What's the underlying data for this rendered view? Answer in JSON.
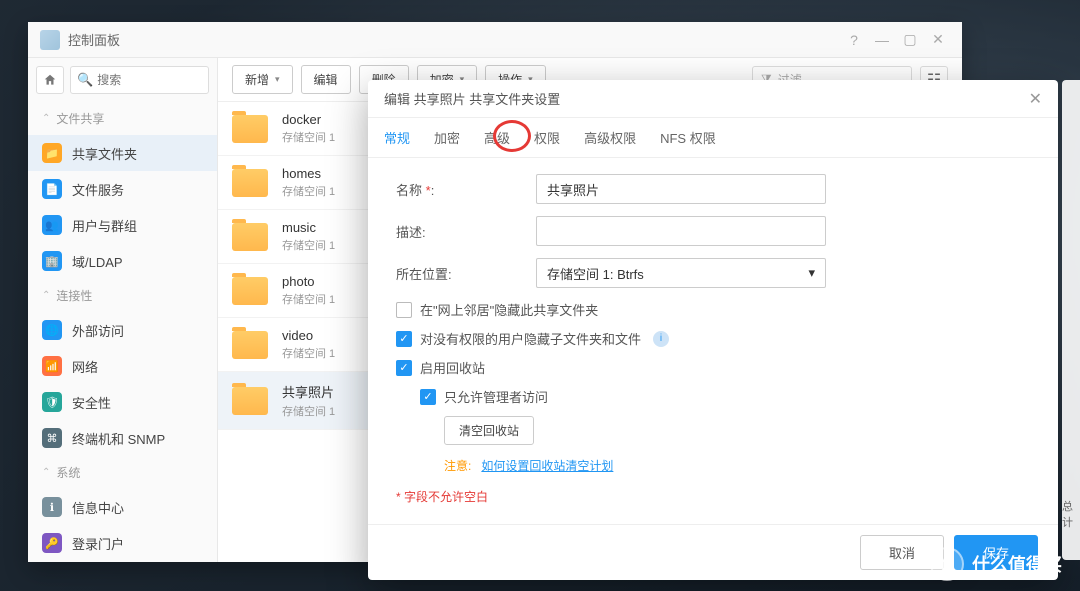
{
  "window": {
    "title": "控制面板"
  },
  "search": {
    "placeholder": "搜索"
  },
  "sections": {
    "file_share": "文件共享",
    "connectivity": "连接性",
    "system": "系统"
  },
  "nav": {
    "shared_folders": "共享文件夹",
    "file_services": "文件服务",
    "users_groups": "用户与群组",
    "domain_ldap": "域/LDAP",
    "external_access": "外部访问",
    "network": "网络",
    "security": "安全性",
    "terminal_snmp": "终端机和 SNMP",
    "info_center": "信息中心",
    "login_portal": "登录门户"
  },
  "toolbar": {
    "new": "新增",
    "edit": "编辑",
    "delete": "删除",
    "encrypt": "加密",
    "action": "操作",
    "filter_placeholder": "过滤"
  },
  "folders": [
    {
      "name": "docker",
      "location": "存储空间 1"
    },
    {
      "name": "homes",
      "location": "存储空间 1"
    },
    {
      "name": "music",
      "location": "存储空间 1"
    },
    {
      "name": "photo",
      "location": "存储空间 1"
    },
    {
      "name": "video",
      "location": "存储空间 1"
    },
    {
      "name": "共享照片",
      "location": "存储空间 1"
    }
  ],
  "dialog": {
    "title": "编辑 共享照片 共享文件夹设置",
    "tabs": {
      "general": "常规",
      "encryption": "加密",
      "advanced": "高级",
      "permission": "权限",
      "adv_permission": "高级权限",
      "nfs_permission": "NFS 权限"
    },
    "labels": {
      "name": "名称",
      "description": "描述",
      "location": "所在位置"
    },
    "values": {
      "name": "共享照片",
      "location": "存储空间 1:   Btrfs"
    },
    "checks": {
      "hide_in_network": "在\"网上邻居\"隐藏此共享文件夹",
      "hide_sub": "对没有权限的用户隐藏子文件夹和文件",
      "enable_recycle": "启用回收站",
      "only_admin": "只允许管理者访问"
    },
    "btn_empty_recycle": "清空回收站",
    "hint_warn": "注意:",
    "hint_link": "如何设置回收站清空计划",
    "footnote": "* 字段不允许空白",
    "cancel": "取消",
    "save": "保存"
  },
  "watermark": "什么值得买",
  "side_label": "总计"
}
